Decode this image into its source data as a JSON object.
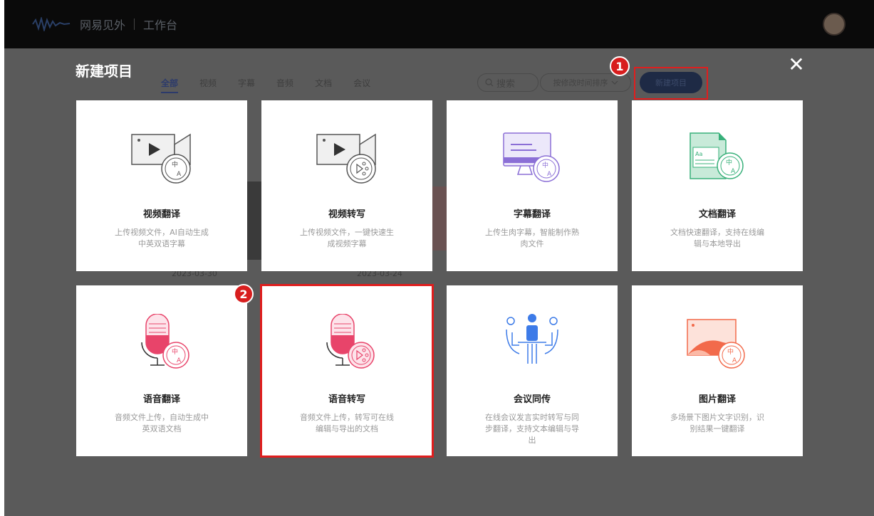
{
  "header": {
    "logo_text": "网易见外",
    "workspace": "工作台"
  },
  "modal": {
    "title": "新建项目",
    "tabs": [
      {
        "label": "全部",
        "active": true
      },
      {
        "label": "视频"
      },
      {
        "label": "字幕"
      },
      {
        "label": "音频"
      },
      {
        "label": "文档"
      },
      {
        "label": "会议"
      }
    ],
    "search_label": "搜索",
    "sort_label": "按修改时间排序",
    "new_project_label": "新建项目",
    "close_symbol": "✕",
    "badge1": "1",
    "badge2": "2",
    "bg_dates": [
      "2023-03-30",
      "2023-03-24"
    ],
    "cards": [
      {
        "title": "视频翻译",
        "desc": "上传视频文件，AI自动生成中英双语字幕",
        "icon": "video-translate-icon"
      },
      {
        "title": "视频转写",
        "desc": "上传视频文件，一键快速生成视频字幕",
        "icon": "video-transcribe-icon"
      },
      {
        "title": "字幕翻译",
        "desc": "上传生肉字幕，智能制作熟肉文件",
        "icon": "subtitle-translate-icon"
      },
      {
        "title": "文档翻译",
        "desc": "文档快速翻译，支持在线编辑与本地导出",
        "icon": "document-translate-icon"
      },
      {
        "title": "语音翻译",
        "desc": "音频文件上传，自动生成中英双语文档",
        "icon": "audio-translate-icon"
      },
      {
        "title": "语音转写",
        "desc": "音频文件上传，转写可在线编辑与导出的文档",
        "icon": "audio-transcribe-icon"
      },
      {
        "title": "会议同传",
        "desc": "在线会议发言实时转写与同步翻译，支持文本编辑与导出",
        "icon": "meeting-interpret-icon"
      },
      {
        "title": "图片翻译",
        "desc": "多场景下图片文字识别，识别结果一键翻译",
        "icon": "image-translate-icon"
      }
    ],
    "icon_text": {
      "zh": "中",
      "en": "A",
      "aa": "Aa"
    }
  },
  "colors": {
    "highlight": "#e01e1e",
    "accent_blue": "#2c3a6b",
    "pink": "#e8446a",
    "green": "#38b07a",
    "purple": "#8b6fd6",
    "blue": "#3d7be8",
    "orange": "#f26a4b"
  }
}
